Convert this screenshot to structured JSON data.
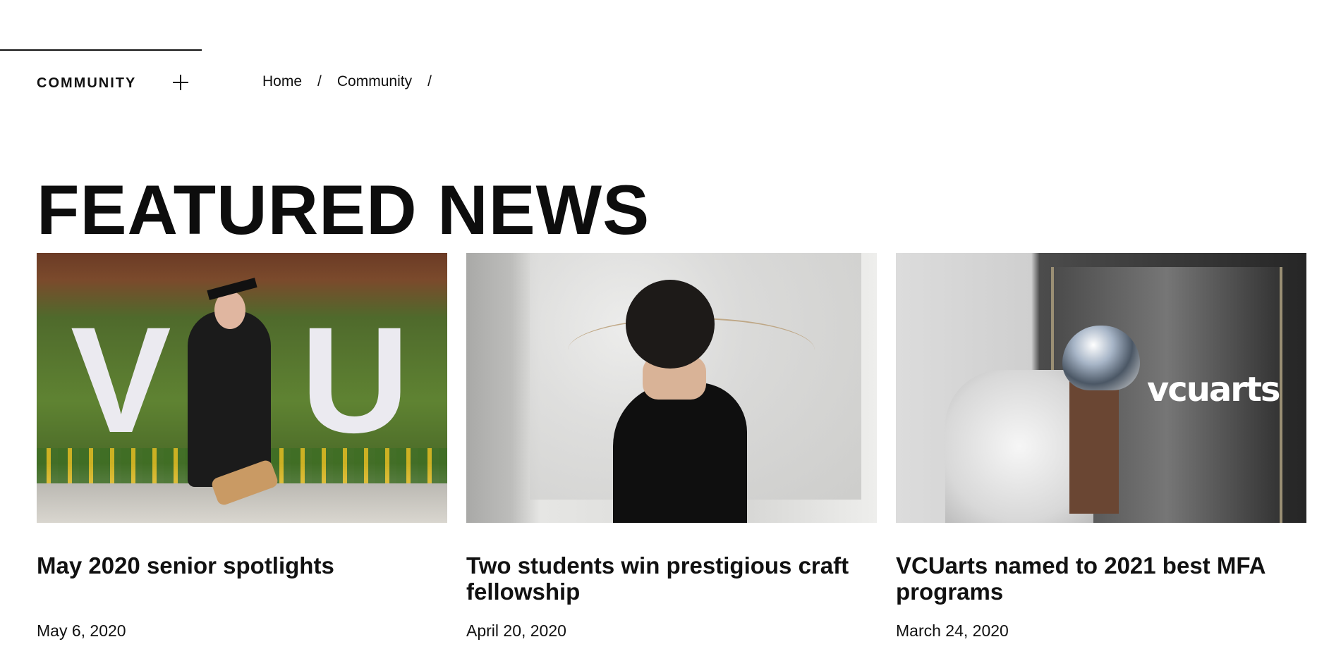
{
  "section": {
    "label": "COMMUNITY"
  },
  "breadcrumb": {
    "items": [
      "Home",
      "Community"
    ],
    "separator": "/"
  },
  "featured": {
    "heading": "FEATURED NEWS",
    "cards": [
      {
        "title": "May 2020 senior spotlights",
        "date": "May 6, 2020",
        "image_letters": [
          "V",
          "U"
        ]
      },
      {
        "title": "Two students win prestigious craft fellowship",
        "date": "April 20, 2020"
      },
      {
        "title": "VCUarts named to 2021 best MFA programs",
        "date": "March 24, 2020",
        "image_logo": "vcuarts"
      }
    ]
  },
  "icons": {
    "expand": "plus-icon"
  }
}
